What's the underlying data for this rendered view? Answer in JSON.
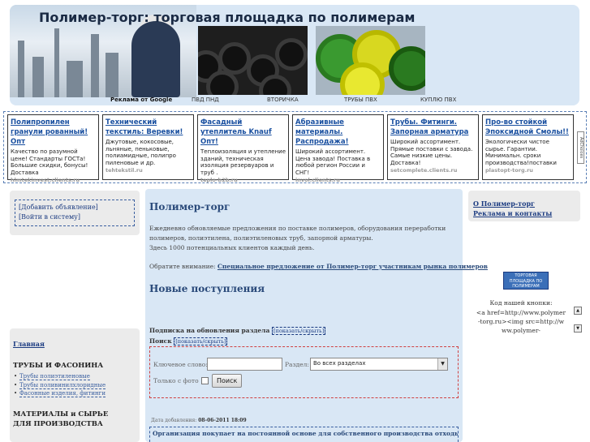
{
  "header": {
    "title": "Полимер-торг: торговая площадка по полимерам",
    "links": {
      "ads_by": "Реклама от Google",
      "l1": "ПВД ПНД",
      "l2": "ВТОРИЧКА",
      "l3": "ТРУБЫ ПВХ",
      "l4": "КУПЛЮ ПВХ"
    }
  },
  "ads": [
    {
      "title": "Полипропилен гранули рованный! Опт",
      "text": "Качество по разумной цене! Стандарты ГОСТа! Большие скидки, бонусы! Доставка",
      "url": "hlmtekinvest.clients.ru"
    },
    {
      "title": "Технический текстиль: Веревки!",
      "text": "Джутовые, кокосовые, льняные, пеньковые, полиамидные, полипро пиленовые и др.",
      "url": "tehtekstil.ru"
    },
    {
      "title": "Фасадный утеплитель Knauf Опт!",
      "text": "Теплоизоляция и утепление зданий, техническая изоляция резервуаров и труб .",
      "url": "teplo-b2b.ru"
    },
    {
      "title": "Абразивные материалы. Распродажа!",
      "text": "Широкий ассортимент. Цена завода! Поставка в любой регион России и СНГ!",
      "url": "invol.clients.ru"
    },
    {
      "title": "Трубы. Фитинги. Запорная арматура",
      "text": "Широкий ассортимент. Прямые поставки с завода. Самые низкие цены. Доставка!",
      "url": "setcomplete.clients.ru"
    },
    {
      "title": "Про-во стойкой Эпоксидной Смолы!!",
      "text": "Экологически чистое сырье. Гарантии. Минимальн. сроки производства!поставки",
      "url": "plastopt-torg.ru"
    }
  ],
  "ad_choices": "AdChoices",
  "left": {
    "add_ad": "[Добавить объявление]",
    "login": "[Войти в систему]",
    "home": "Главная",
    "section1": "ТРУБЫ И ФАСОНИНА",
    "section1_items": [
      "Трубы полиэтиленовые",
      "Трубы поливинилхлоридные",
      "Фасонные изделия, фитинги"
    ],
    "section2": "МАТЕРИАЛЫ и СЫРЬЕ ДЛЯ ПРОИЗВОДСТВА"
  },
  "main": {
    "title": "Полимер-торг",
    "intro": "Ежедневно обновляемые предложения по поставке полимеров, оборудования переработки полимеров, полиэтилена, полиэтиленовых труб, запорной арматуры.",
    "intro2": "Здесь 1000 потенциальных клиентов каждый день.",
    "notice_label": "Обратите внимание:",
    "notice_link": "Специальное предложение от Полимер-торг участникам рынка полимеров",
    "new_title": "Новые поступления",
    "subscribe_label": "Подписка на обновления раздела",
    "subscribe_toggle": "[показать/скрыть]",
    "search_label": "Поиск",
    "search_toggle": "[показать/скрыть]",
    "search": {
      "keyword_label": "Ключевое слово:",
      "keyword_value": "",
      "section_label": "Раздел:",
      "section_value": "Во всех разделах",
      "photo_label": "Только с фото",
      "button": "Поиск"
    },
    "date_label": "Дата добавления:",
    "date_value": "08-06-2011 18:09",
    "first_item": "Организация покупает на постоянной основе для собственного производства отходы пэ, пп,"
  },
  "right": {
    "about": "О Полимер-торг",
    "ads_contacts": "Реклама и контакты",
    "logo_text": "ТОРГОВАЯ ПЛОЩАДКА ПО ПОЛИМЕРАМ",
    "code_label": "Код нашей кнопки:",
    "code_text": "<a href=http://www.polymer-torg.ru><img src=http://www.polymer-"
  },
  "colors": {
    "panel_blue": "#d9e7f5",
    "link_blue": "#1a3a80",
    "panel_gray": "#ebebeb"
  }
}
